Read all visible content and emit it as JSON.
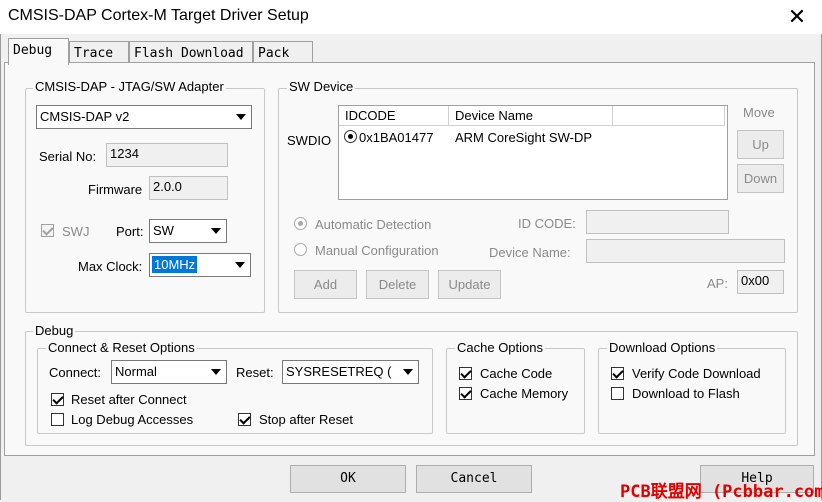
{
  "window": {
    "title": "CMSIS-DAP Cortex-M Target Driver Setup",
    "close_glyph": "✕"
  },
  "tabs": [
    {
      "label": "Debug",
      "active": true
    },
    {
      "label": "Trace",
      "active": false
    },
    {
      "label": "Flash Download",
      "active": false
    },
    {
      "label": "Pack",
      "active": false
    }
  ],
  "adapter": {
    "group_label": "CMSIS-DAP - JTAG/SW Adapter",
    "selected": "CMSIS-DAP v2",
    "serial_label": "Serial No:",
    "serial_value": "1234",
    "firmware_label": "Firmware",
    "firmware_value": "2.0.0",
    "swj_label": "SWJ",
    "port_label": "Port:",
    "port_value": "SW",
    "maxclock_label": "Max Clock:",
    "maxclock_value": "10MHz"
  },
  "sw_device": {
    "group_label": "SW Device",
    "row_label": "SWDIO",
    "columns": [
      "IDCODE",
      "Device Name"
    ],
    "rows": [
      {
        "idcode": "0x1BA01477",
        "name": "ARM CoreSight SW-DP"
      }
    ],
    "move_label": "Move",
    "up_label": "Up",
    "down_label": "Down",
    "auto_label": "Automatic Detection",
    "manual_label": "Manual Configuration",
    "idcode_label": "ID CODE:",
    "devname_label": "Device Name:",
    "ap_label": "AP:",
    "ap_value": "0x00",
    "add_label": "Add",
    "delete_label": "Delete",
    "update_label": "Update"
  },
  "debug": {
    "group_label": "Debug",
    "connect_reset": {
      "group_label": "Connect & Reset Options",
      "connect_label": "Connect:",
      "connect_value": "Normal",
      "reset_label": "Reset:",
      "reset_value": "SYSRESETREQ (",
      "reset_after_connect": "Reset after Connect",
      "log_debug": "Log Debug Accesses",
      "stop_after_reset": "Stop after Reset"
    },
    "cache": {
      "group_label": "Cache Options",
      "cache_code": "Cache Code",
      "cache_memory": "Cache Memory"
    },
    "download": {
      "group_label": "Download Options",
      "verify": "Verify Code Download",
      "to_flash": "Download to Flash"
    }
  },
  "footer": {
    "ok_label": "OK",
    "cancel_label": "Cancel",
    "help_label": "Help"
  },
  "watermark": "PCB联盟网 (Pcbbar.com)",
  "colors": {
    "selection": "#0078d7",
    "watermark": "#e00000"
  }
}
